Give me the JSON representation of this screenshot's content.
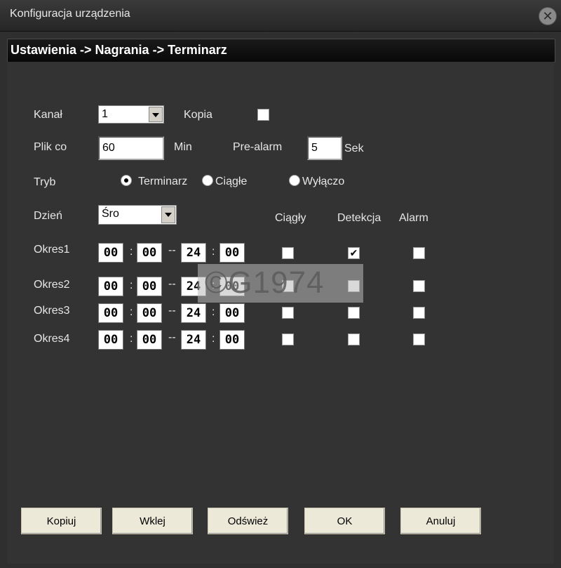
{
  "window": {
    "title": "Konfiguracja urządzenia"
  },
  "breadcrumb": "Ustawienia -> Nagrania -> Terminarz",
  "form": {
    "kanal_label": "Kanał",
    "kanal_value": "1",
    "kopia_label": "Kopia",
    "plik_label": "Plik co",
    "plik_value": "60",
    "min_label": "Min",
    "prealarm_label": "Pre-alarm",
    "prealarm_value": "5",
    "sek_label": "Sek",
    "tryb_label": "Tryb",
    "tryb_options": [
      "Terminarz",
      "Ciągłe",
      "Wyłączo"
    ],
    "tryb_selected": "Terminarz",
    "dzien_label": "Dzień",
    "dzien_value": "Śro",
    "col_headers": [
      "Ciągły",
      "Detekcja",
      "Alarm"
    ],
    "periods": [
      {
        "label": "Okres1",
        "start_h": "00",
        "start_m": "00",
        "end_h": "24",
        "end_m": "00",
        "ciagly": false,
        "detekcja": true,
        "alarm": false
      },
      {
        "label": "Okres2",
        "start_h": "00",
        "start_m": "00",
        "end_h": "24",
        "end_m": "00",
        "ciagly": false,
        "detekcja": false,
        "alarm": false
      },
      {
        "label": "Okres3",
        "start_h": "00",
        "start_m": "00",
        "end_h": "24",
        "end_m": "00",
        "ciagly": false,
        "detekcja": false,
        "alarm": false
      },
      {
        "label": "Okres4",
        "start_h": "00",
        "start_m": "00",
        "end_h": "24",
        "end_m": "00",
        "ciagly": false,
        "detekcja": false,
        "alarm": false
      }
    ]
  },
  "buttons": {
    "kopiuj": "Kopiuj",
    "wklej": "Wklej",
    "odswiez": "Odśwież",
    "ok": "OK",
    "anuluj": "Anuluj"
  },
  "watermark": "©G1974",
  "check_glyph": "✔"
}
